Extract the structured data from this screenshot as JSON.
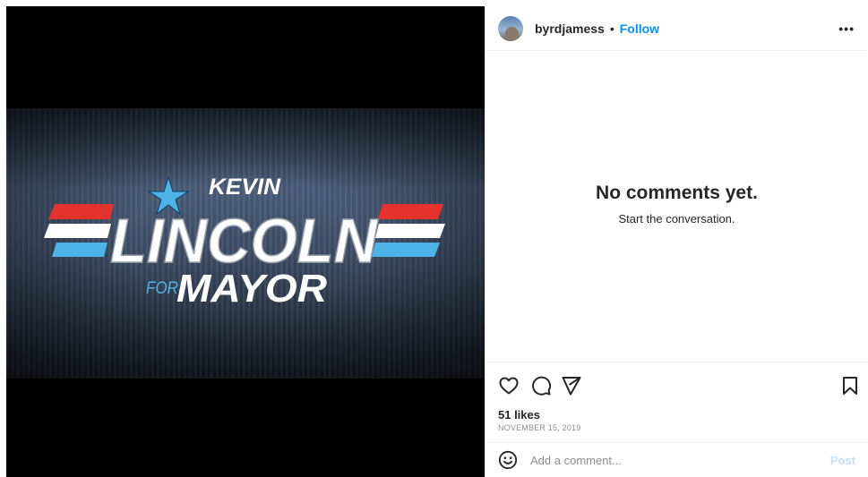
{
  "media": {
    "logo": {
      "line1": "KEVIN",
      "line2": "LINCOLN",
      "line3a": "FOR",
      "line3b": "MAYOR"
    },
    "colors": {
      "red": "#e5322c",
      "white": "#ffffff",
      "blue": "#4db3e6",
      "background": "#3c4c64"
    }
  },
  "header": {
    "username": "byrdjamess",
    "separator": "•",
    "follow_label": "Follow",
    "more_label": "•••"
  },
  "comments": {
    "empty_title": "No comments yet.",
    "empty_subtitle": "Start the conversation."
  },
  "actions": {
    "icons": [
      "heart-icon",
      "comment-icon",
      "share-icon",
      "bookmark-icon"
    ],
    "likes": "51 likes",
    "date": "NOVEMBER 15, 2019"
  },
  "comment_bar": {
    "placeholder": "Add a comment...",
    "post_label": "Post"
  },
  "theme": {
    "link": "#0095f6",
    "post_disabled": "#c0dffd",
    "muted": "#8e8e8e"
  }
}
